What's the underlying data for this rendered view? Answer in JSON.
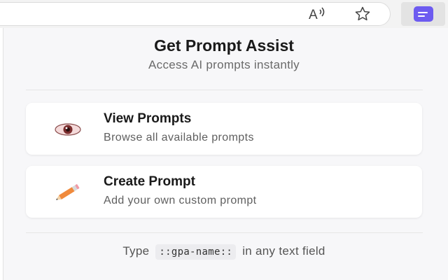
{
  "toolbar": {
    "read_aloud_icon": "read-aloud-icon",
    "favorite_icon": "star-outline-icon",
    "extension_icon": "prompt-assist-extension-icon",
    "extension_color": "#6d5bf0"
  },
  "popup": {
    "title": "Get Prompt Assist",
    "subtitle": "Access AI prompts instantly",
    "cards": [
      {
        "icon": "eye-icon",
        "title": "View Prompts",
        "description": "Browse all available prompts"
      },
      {
        "icon": "pencil-icon",
        "title": "Create Prompt",
        "description": "Add your own custom prompt"
      }
    ],
    "footer": {
      "prefix": "Type",
      "code": "::gpa-name::",
      "suffix": "in any text field"
    }
  }
}
